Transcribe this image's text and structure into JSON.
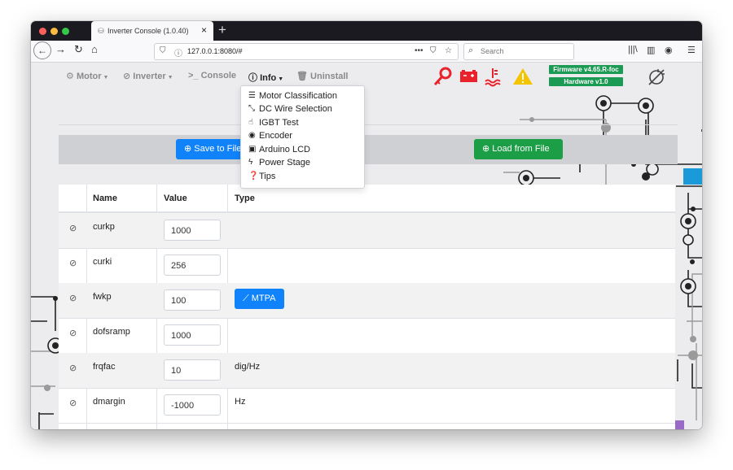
{
  "browser": {
    "tab_title": "Inverter Console (1.0.40)",
    "url": "127.0.0.1:8080/#",
    "search_placeholder": "Search",
    "url_more": "•••"
  },
  "appnav": {
    "motor": "Motor",
    "inverter": "Inverter",
    "console": "Console",
    "info": "Info",
    "uninstall": "Uninstall",
    "firmware": "Firmware v4.65.R-foc",
    "hardware": "Hardware v1.0"
  },
  "colors": {
    "accent_blue": "#1083fb",
    "success_green": "#1b9e45",
    "alert_red": "#e8232b",
    "warning_yellow": "#f5c400"
  },
  "buttons": {
    "save": "Save to File",
    "load": "Load from File",
    "mtpa": "MTPA"
  },
  "info_menu": [
    {
      "label": "Motor Classification",
      "icon": "list-icon"
    },
    {
      "label": "DC Wire Selection",
      "icon": "arrows-icon"
    },
    {
      "label": "IGBT Test",
      "icon": "hand-icon"
    },
    {
      "label": "Encoder",
      "icon": "dot-circle-icon"
    },
    {
      "label": "Arduino LCD",
      "icon": "lcd-icon"
    },
    {
      "label": "Power Stage",
      "icon": "bolt-icon"
    },
    {
      "label": "Tips",
      "icon": "question-icon"
    }
  ],
  "table": {
    "headers": [
      "Name",
      "Value",
      "Type"
    ],
    "rows": [
      {
        "name": "curkp",
        "value": "1000",
        "type": ""
      },
      {
        "name": "curki",
        "value": "256",
        "type": ""
      },
      {
        "name": "fwkp",
        "value": "100",
        "type": ""
      },
      {
        "name": "dofsramp",
        "value": "1000",
        "type": ""
      },
      {
        "name": "frqfac",
        "value": "10",
        "type": "dig/Hz"
      },
      {
        "name": "dmargin",
        "value": "-1000",
        "type": "Hz"
      }
    ]
  }
}
